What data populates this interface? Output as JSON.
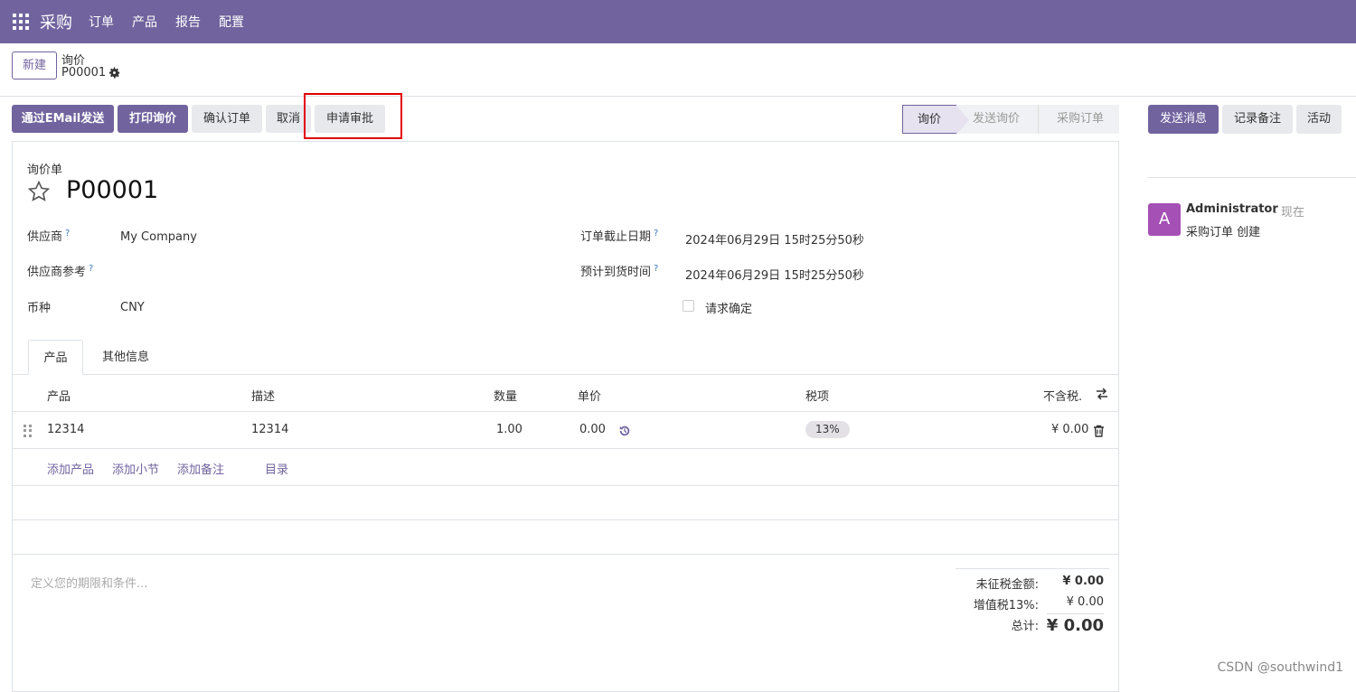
{
  "topbar": {
    "app_name": "采购",
    "menu": [
      "订单",
      "产品",
      "报告",
      "配置"
    ]
  },
  "control_panel": {
    "new_button": "新建",
    "breadcrumb_parent": "询价",
    "breadcrumb_current": "P00001"
  },
  "actions": {
    "send_email": "通过EMail发送",
    "print_rfq": "打印询价",
    "confirm_order": "确认订单",
    "cancel": "取消",
    "request_approval": "申请审批"
  },
  "statusbar": [
    "询价",
    "发送询价",
    "采购订单"
  ],
  "chatter": {
    "send_message": "发送消息",
    "log_note": "记录备注",
    "activity": "活动",
    "message": {
      "avatar_letter": "A",
      "author": "Administrator",
      "time": "- 现在",
      "body": "采购订单 创建"
    }
  },
  "form": {
    "doc_label": "询价单",
    "doc_title": "P00001",
    "vendor_label": "供应商",
    "vendor_value": "My Company",
    "vendor_ref_label": "供应商参考",
    "currency_label": "币种",
    "currency_value": "CNY",
    "deadline_label": "订单截止日期",
    "deadline_value": "2024年06月29日 15时25分50秒",
    "expected_arrival_label": "预计到货时间",
    "expected_arrival_value": "2024年06月29日 15时25分50秒",
    "ask_confirmation_label": "请求确定",
    "help_mark": "?"
  },
  "tabs": [
    "产品",
    "其他信息"
  ],
  "lines": {
    "headers": {
      "product": "产品",
      "description": "描述",
      "quantity": "数量",
      "unit_price": "单价",
      "taxes": "税项",
      "subtotal": "不含税."
    },
    "rows": [
      {
        "product": "12314",
        "description": "12314",
        "quantity": "1.00",
        "unit_price": "0.00",
        "tax": "13%",
        "subtotal": "¥ 0.00"
      }
    ],
    "add_links": [
      "添加产品",
      "添加小节",
      "添加备注",
      "目录"
    ]
  },
  "terms_placeholder": "定义您的期限和条件...",
  "totals": {
    "untaxed_label": "未征税金额:",
    "untaxed_value": "¥ 0.00",
    "vat_label": "增值税13%:",
    "vat_value": "¥ 0.00",
    "total_label": "总计:",
    "total_value": "¥ 0.00"
  },
  "watermark": "CSDN @southwind1",
  "colors": {
    "brand": "#71639e",
    "highlight": "#e10000",
    "avatar": "#a550b5"
  }
}
